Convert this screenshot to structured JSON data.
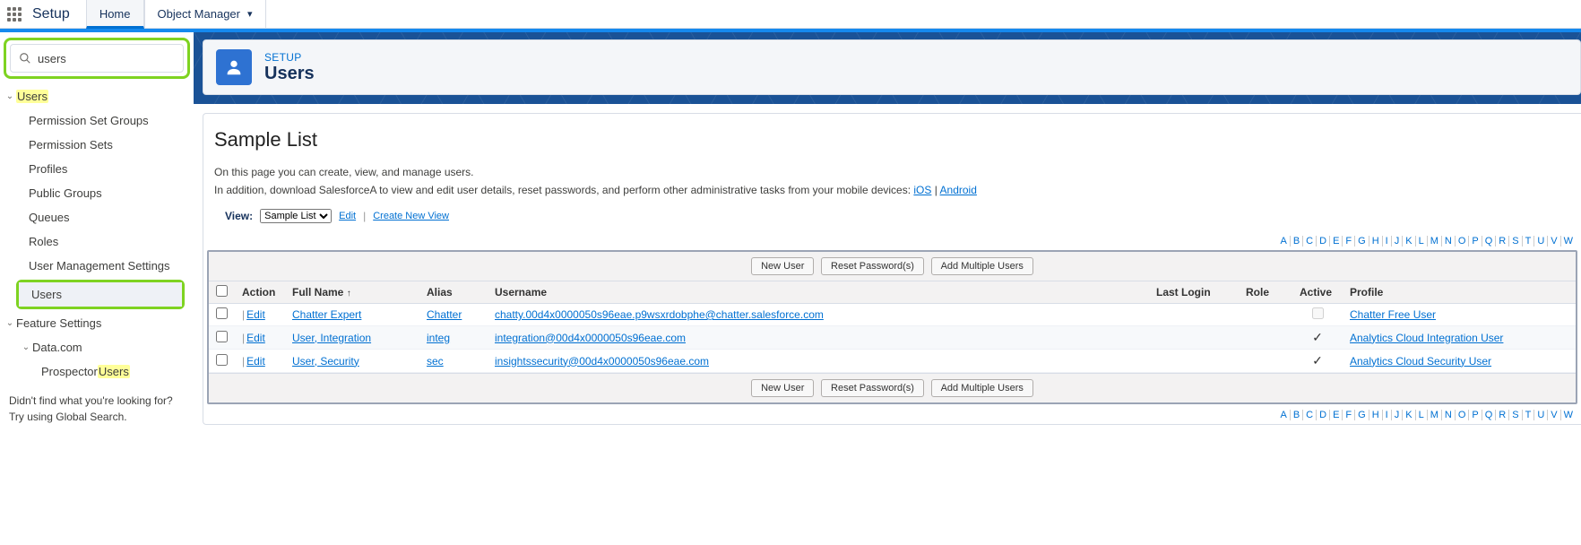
{
  "topbar": {
    "setup": "Setup",
    "home": "Home",
    "object_manager": "Object Manager"
  },
  "sidebar": {
    "search_value": "users",
    "items": {
      "users_group": "Users",
      "perm_set_groups": "Permission Set Groups",
      "perm_sets": "Permission Sets",
      "profiles": "Profiles",
      "public_groups": "Public Groups",
      "queues": "Queues",
      "roles": "Roles",
      "user_mgmt": "User Management Settings",
      "users_item": "Users",
      "feature_settings": "Feature Settings",
      "datacom": "Data.com",
      "prospector_prefix": "Prospector ",
      "prospector_hl": "Users"
    },
    "footnote1": "Didn't find what you're looking for?",
    "footnote2": "Try using Global Search."
  },
  "header": {
    "kicker": "SETUP",
    "title": "Users"
  },
  "page": {
    "title": "Sample List",
    "desc1": "On this page you can create, view, and manage users.",
    "desc2_prefix": "In addition, download SalesforceA to view and edit user details, reset passwords, and perform other administrative tasks from your mobile devices: ",
    "ios": "iOS",
    "sep": " | ",
    "android": "Android",
    "view_label": "View:",
    "view_value": "Sample List",
    "edit": "Edit",
    "create_view": "Create New View"
  },
  "buttons": {
    "new_user": "New User",
    "reset_pw": "Reset Password(s)",
    "add_multi": "Add Multiple Users"
  },
  "columns": {
    "action": "Action",
    "full_name": "Full Name",
    "alias": "Alias",
    "username": "Username",
    "last_login": "Last Login",
    "role": "Role",
    "active": "Active",
    "profile": "Profile"
  },
  "action_label": "Edit",
  "rows": [
    {
      "name": "Chatter Expert",
      "alias": "Chatter",
      "username": "chatty.00d4x0000050s96eae.p9wsxrdobphe@chatter.salesforce.com",
      "active": false,
      "profile": "Chatter Free User"
    },
    {
      "name": "User, Integration",
      "alias": "integ",
      "username": "integration@00d4x0000050s96eae.com",
      "active": true,
      "profile": "Analytics Cloud Integration User"
    },
    {
      "name": "User, Security",
      "alias": "sec",
      "username": "insightssecurity@00d4x0000050s96eae.com",
      "active": true,
      "profile": "Analytics Cloud Security User"
    }
  ],
  "alpha": [
    "A",
    "B",
    "C",
    "D",
    "E",
    "F",
    "G",
    "H",
    "I",
    "J",
    "K",
    "L",
    "M",
    "N",
    "O",
    "P",
    "Q",
    "R",
    "S",
    "T",
    "U",
    "V",
    "W"
  ]
}
